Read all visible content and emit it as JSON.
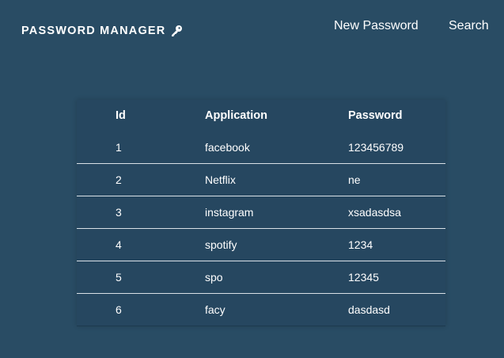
{
  "navbar": {
    "brand": "PASSWORD MANAGER",
    "links": {
      "new_password": "New Password",
      "search": "Search"
    }
  },
  "table": {
    "headers": {
      "id": "Id",
      "application": "Application",
      "password": "Password"
    },
    "rows": [
      {
        "id": "1",
        "application": "facebook",
        "password": "123456789"
      },
      {
        "id": "2",
        "application": "Netflix",
        "password": "ne"
      },
      {
        "id": "3",
        "application": "instagram",
        "password": "xsadasdsa"
      },
      {
        "id": "4",
        "application": "spotify",
        "password": "1234"
      },
      {
        "id": "5",
        "application": "spo",
        "password": "12345"
      },
      {
        "id": "6",
        "application": "facy",
        "password": "dasdasd"
      }
    ]
  },
  "colors": {
    "background": "#294c64",
    "table_background": "#264760",
    "text": "#ffffff"
  }
}
